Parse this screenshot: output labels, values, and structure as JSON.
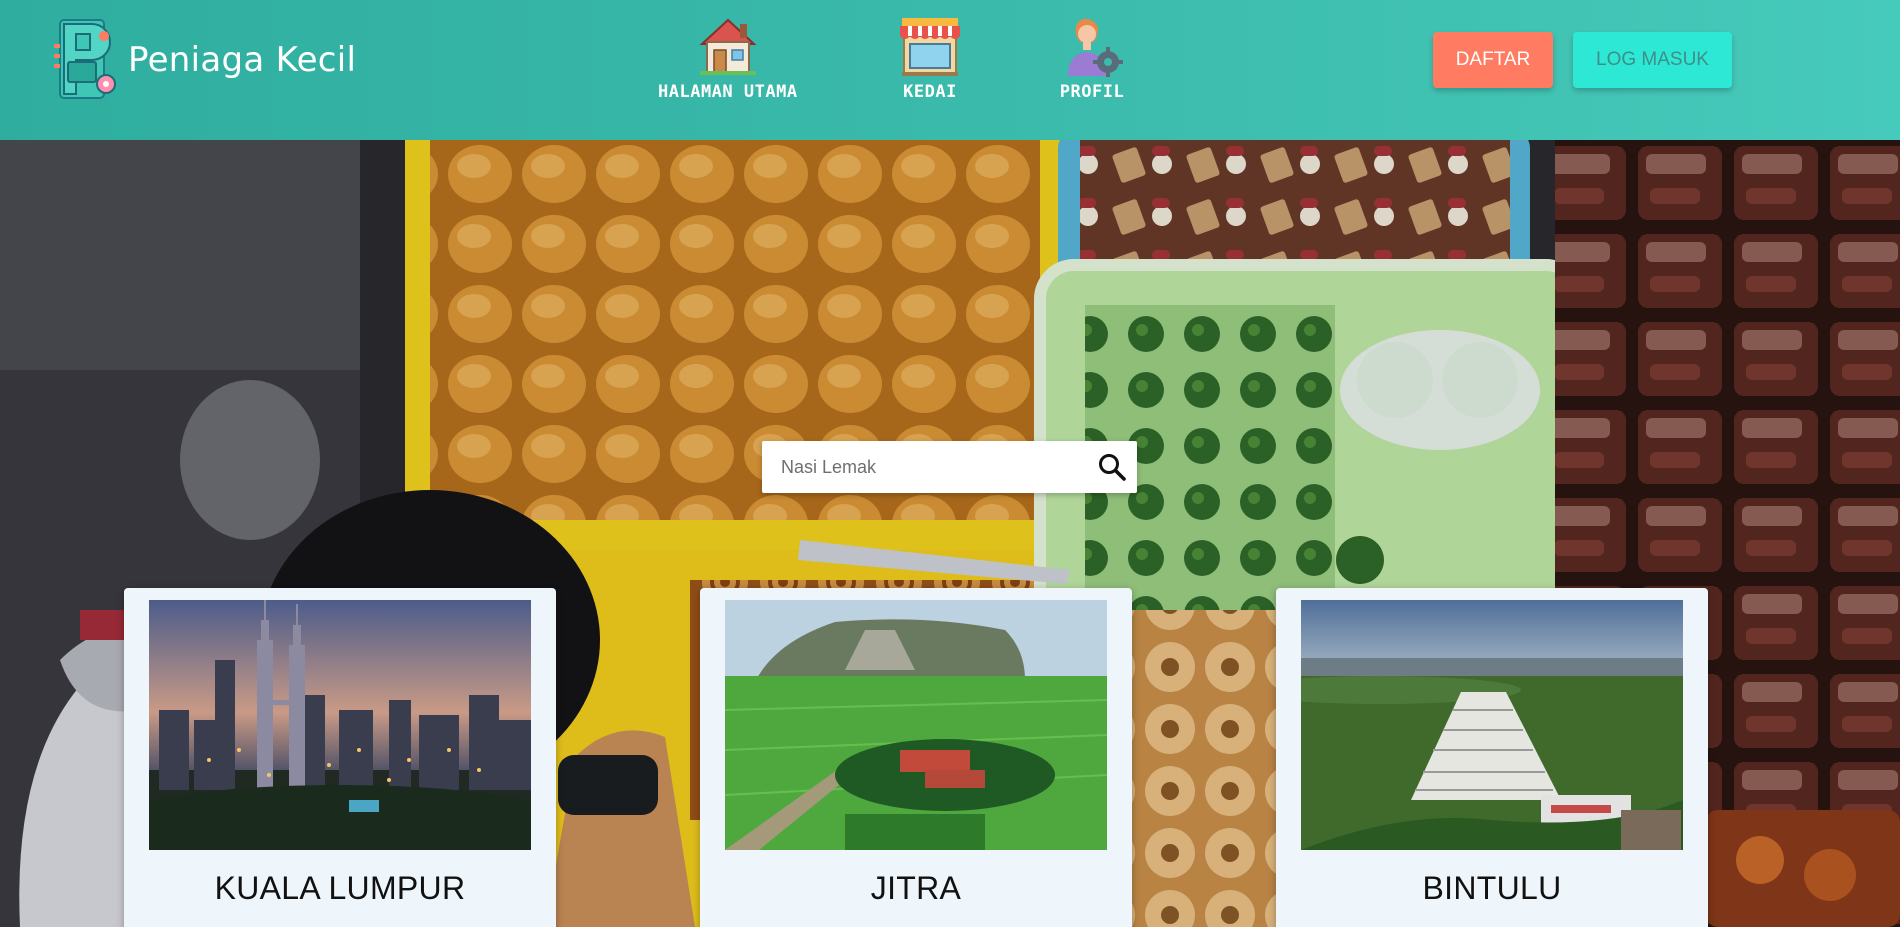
{
  "app": {
    "brand_name": "Peniaga Kecil"
  },
  "nav": {
    "items": [
      {
        "label": "HALAMAN UTAMA",
        "icon": "house-icon"
      },
      {
        "label": "KEDAI",
        "icon": "shop-icon"
      },
      {
        "label": "PROFIL",
        "icon": "profile-gear-icon"
      }
    ]
  },
  "auth": {
    "register_label": "DAFTAR",
    "login_label": "LOG MASUK"
  },
  "search": {
    "placeholder": "Nasi Lemak",
    "value": ""
  },
  "cities": [
    {
      "name": "KUALA LUMPUR",
      "image": "city-skyline-night"
    },
    {
      "name": "JITRA",
      "image": "green-paddy-field-hill"
    },
    {
      "name": "BINTULU",
      "image": "cone-building-coast"
    }
  ],
  "colors": {
    "header": "#3bbbab",
    "register_button": "#ff7b62",
    "login_button": "#2ee8d6",
    "card_background": "#eef6fb"
  }
}
